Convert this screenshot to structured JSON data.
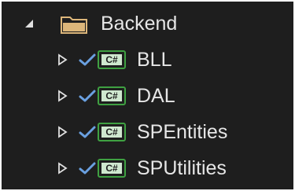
{
  "tree": {
    "folder": {
      "label": "Backend",
      "expanded": true,
      "icon": "folder-icon",
      "expander_icon": "triangle-down-icon"
    },
    "projects": [
      {
        "label": "BLL",
        "icon": "csharp-project-icon",
        "status_icon": "checkmark-icon",
        "badge": "C#"
      },
      {
        "label": "DAL",
        "icon": "csharp-project-icon",
        "status_icon": "checkmark-icon",
        "badge": "C#"
      },
      {
        "label": "SPEntities",
        "icon": "csharp-project-icon",
        "status_icon": "checkmark-icon",
        "badge": "C#"
      },
      {
        "label": "SPUtilities",
        "icon": "csharp-project-icon",
        "status_icon": "checkmark-icon",
        "badge": "C#"
      }
    ]
  },
  "colors": {
    "background": "#1e1e1e",
    "text": "#e6e6e6",
    "folder": "#dcb67a",
    "checkmark": "#6aa0e0",
    "csharp_border": "#3fa142",
    "csharp_fill": "#cfe8cf",
    "csharp_text": "#1e1e1e"
  }
}
